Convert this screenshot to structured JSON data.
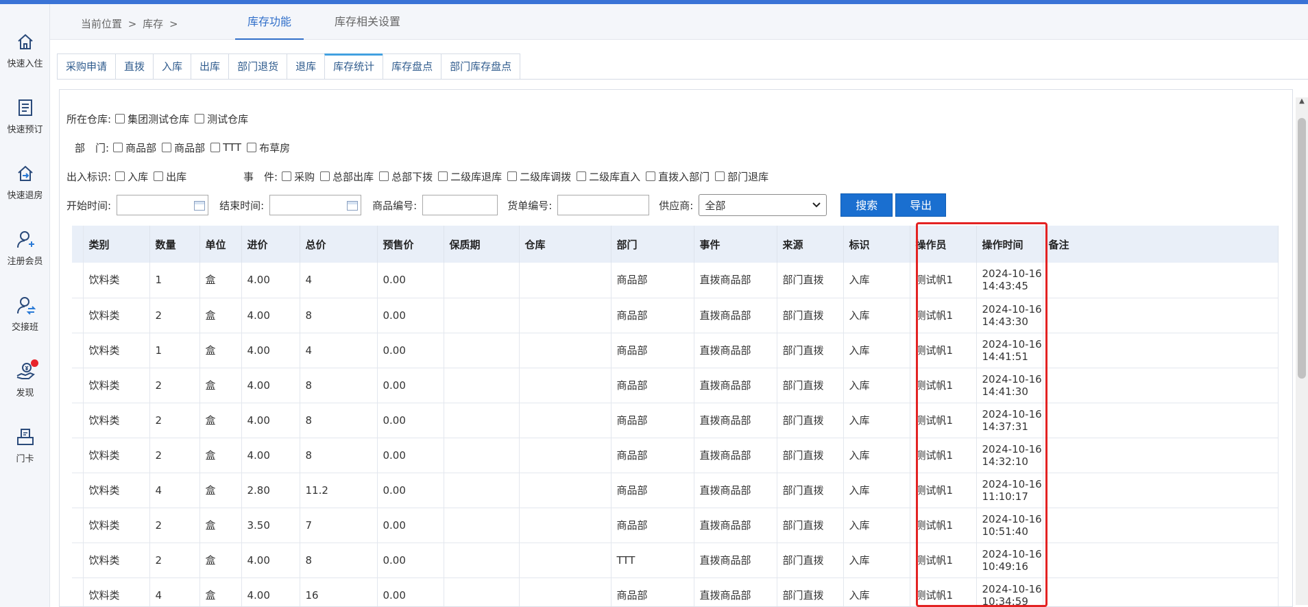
{
  "sidebar": [
    {
      "icon": "home-icon",
      "label": "快速入住"
    },
    {
      "icon": "booking-icon",
      "label": "快速预订"
    },
    {
      "icon": "checkout-icon",
      "label": "快速退房"
    },
    {
      "icon": "add-member-icon",
      "label": "注册会员"
    },
    {
      "icon": "shift-handover-icon",
      "label": "交接班"
    },
    {
      "icon": "discover-icon",
      "label": "发现"
    },
    {
      "icon": "door-card-icon",
      "label": "门卡"
    }
  ],
  "breadcrumb": {
    "prefix": "当前位置",
    "sep": ">",
    "section": "库存",
    "sep2": ">"
  },
  "top_tabs": [
    {
      "label": "库存功能",
      "active": true
    },
    {
      "label": "库存相关设置",
      "active": false
    }
  ],
  "sub_tabs": [
    {
      "label": "采购申请",
      "active": false
    },
    {
      "label": "直拨",
      "active": false
    },
    {
      "label": "入库",
      "active": false
    },
    {
      "label": "出库",
      "active": false
    },
    {
      "label": "部门退货",
      "active": false
    },
    {
      "label": "退库",
      "active": false
    },
    {
      "label": "库存统计",
      "active": true
    },
    {
      "label": "库存盘点",
      "active": false
    },
    {
      "label": "部门库存盘点",
      "active": false
    }
  ],
  "filters": {
    "warehouse": {
      "label": "所在仓库:",
      "options": [
        "集团测试仓库",
        "测试仓库"
      ]
    },
    "department": {
      "label": "部　门:",
      "options": [
        "商品部",
        "商品部",
        "TTT",
        "布草房"
      ]
    },
    "io_flag": {
      "label": "出入标识:",
      "options": [
        "入库",
        "出库"
      ]
    },
    "event": {
      "label": "事　件:",
      "options": [
        "采购",
        "总部出库",
        "总部下拨",
        "二级库退库",
        "二级库调拨",
        "二级库直入",
        "直拨入部门",
        "部门退库"
      ]
    },
    "start_time": {
      "label": "开始时间:",
      "value": ""
    },
    "end_time": {
      "label": "结束时间:",
      "value": ""
    },
    "product_no": {
      "label": "商品编号:",
      "value": ""
    },
    "bill_no": {
      "label": "货单编号:",
      "value": ""
    },
    "supplier": {
      "label": "供应商:",
      "value": "全部"
    },
    "search_label": "搜索",
    "export_label": "导出"
  },
  "table": {
    "headers": [
      "类别",
      "数量",
      "单位",
      "进价",
      "总价",
      "预售价",
      "保质期",
      "仓库",
      "部门",
      "事件",
      "来源",
      "标识",
      "操作员",
      "操作时间",
      "备注"
    ],
    "rows": [
      [
        "饮料类",
        "1",
        "盒",
        "4.00",
        "4",
        "0.00",
        "",
        "",
        "商品部",
        "直拨商品部",
        "部门直拨",
        "入库",
        "测试帆1",
        "2024-10-16 14:43:45",
        ""
      ],
      [
        "饮料类",
        "2",
        "盒",
        "4.00",
        "8",
        "0.00",
        "",
        "",
        "商品部",
        "直拨商品部",
        "部门直拨",
        "入库",
        "测试帆1",
        "2024-10-16 14:43:30",
        ""
      ],
      [
        "饮料类",
        "1",
        "盒",
        "4.00",
        "4",
        "0.00",
        "",
        "",
        "商品部",
        "直拨商品部",
        "部门直拨",
        "入库",
        "测试帆1",
        "2024-10-16 14:41:51",
        ""
      ],
      [
        "饮料类",
        "2",
        "盒",
        "4.00",
        "8",
        "0.00",
        "",
        "",
        "商品部",
        "直拨商品部",
        "部门直拨",
        "入库",
        "测试帆1",
        "2024-10-16 14:41:30",
        ""
      ],
      [
        "饮料类",
        "2",
        "盒",
        "4.00",
        "8",
        "0.00",
        "",
        "",
        "商品部",
        "直拨商品部",
        "部门直拨",
        "入库",
        "测试帆1",
        "2024-10-16 14:37:31",
        ""
      ],
      [
        "饮料类",
        "2",
        "盒",
        "4.00",
        "8",
        "0.00",
        "",
        "",
        "商品部",
        "直拨商品部",
        "部门直拨",
        "入库",
        "测试帆1",
        "2024-10-16 14:32:10",
        ""
      ],
      [
        "饮料类",
        "4",
        "盒",
        "2.80",
        "11.2",
        "0.00",
        "",
        "",
        "商品部",
        "直拨商品部",
        "部门直拨",
        "入库",
        "测试帆1",
        "2024-10-16 11:10:17",
        ""
      ],
      [
        "饮料类",
        "2",
        "盒",
        "3.50",
        "7",
        "0.00",
        "",
        "",
        "商品部",
        "直拨商品部",
        "部门直拨",
        "入库",
        "测试帆1",
        "2024-10-16 10:51:40",
        ""
      ],
      [
        "饮料类",
        "2",
        "盒",
        "4.00",
        "8",
        "0.00",
        "",
        "",
        "TTT",
        "直拨商品部",
        "部门直拨",
        "入库",
        "测试帆1",
        "2024-10-16 10:49:16",
        ""
      ],
      [
        "饮料类",
        "4",
        "盒",
        "4.00",
        "16",
        "0.00",
        "",
        "",
        "商品部",
        "直拨商品部",
        "部门直拨",
        "入库",
        "测试帆1",
        "2024-10-16 10:34:59",
        ""
      ]
    ]
  },
  "colors": {
    "accent": "#2f6ec9",
    "button": "#1a6fd0",
    "highlight": "#e32222",
    "header_bg": "#e9eff8"
  }
}
